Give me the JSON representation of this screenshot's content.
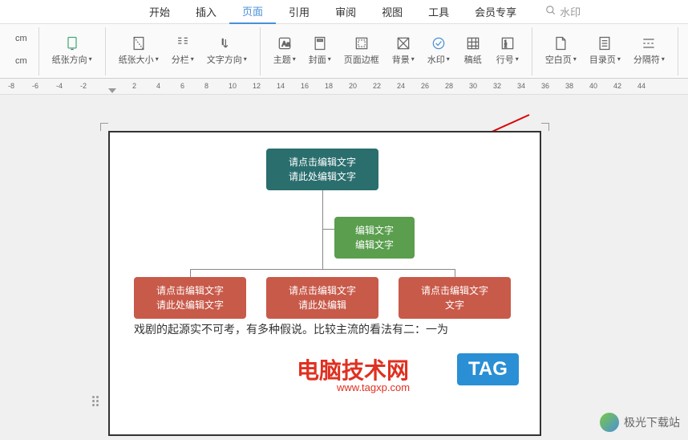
{
  "menu": {
    "items": [
      "开始",
      "插入",
      "页面",
      "引用",
      "审阅",
      "视图",
      "工具",
      "会员专享"
    ],
    "active_index": 2,
    "search_placeholder": "水印"
  },
  "toolbar": {
    "left_small": [
      "cm",
      "cm"
    ],
    "paper_direction": "纸张方向",
    "paper_size": "纸张大小",
    "columns": "分栏",
    "text_direction": "文字方向",
    "theme": "主题",
    "cover": "封面",
    "page_border": "页面边框",
    "background": "背景",
    "watermark": "水印",
    "manuscript": "稿纸",
    "line_number": "行号",
    "blank_page": "空白页",
    "toc": "目录页",
    "separator": "分隔符"
  },
  "ruler": {
    "marks": [
      -8,
      -6,
      -4,
      -2,
      2,
      4,
      6,
      8,
      10,
      12,
      14,
      16,
      18,
      20,
      22,
      24,
      26,
      28,
      30,
      32,
      34,
      36,
      38,
      40,
      42,
      44
    ]
  },
  "chart_data": {
    "type": "org-chart",
    "root": {
      "line1": "请点击编辑文字",
      "line2": "请此处编辑文字",
      "color": "#2a6e6e"
    },
    "middle": {
      "line1": "编辑文字",
      "line2": "编辑文字",
      "color": "#5a9e4e"
    },
    "children": [
      {
        "line1": "请点击编辑文字",
        "line2": "请此处编辑文字",
        "color": "#c85a4a"
      },
      {
        "line1": "请点击编辑文字",
        "line2": "请此处编辑",
        "color": "#c85a4a"
      },
      {
        "line1": "请点击编辑文字",
        "line2": "文字",
        "color": "#c85a4a"
      }
    ]
  },
  "body_text": "戏剧的起源实不可考，有多种假说。比较主流的看法有二：一为",
  "watermarks": {
    "text1": "电脑技术网",
    "text2": "www.tagxp.com",
    "tag": "TAG",
    "footer": "极光下载站"
  }
}
